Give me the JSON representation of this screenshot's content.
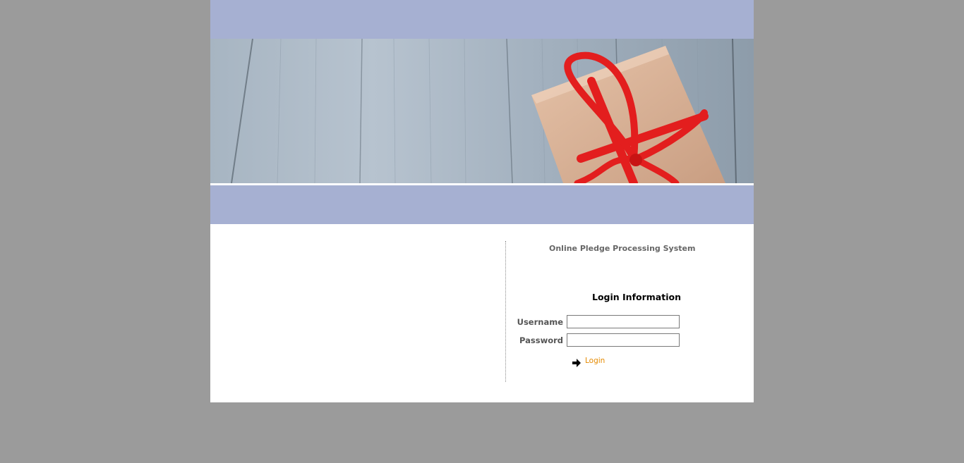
{
  "header": {
    "banner_image": "gift-box-on-wooden-boards"
  },
  "main": {
    "system_title": "Online Pledge Processing System",
    "login_heading": "Login Information",
    "username": {
      "label": "Username",
      "value": ""
    },
    "password": {
      "label": "Password",
      "value": ""
    },
    "login_link": {
      "icon": "arrow-right-icon",
      "label": "Login"
    }
  },
  "colors": {
    "page_background": "#9b9b9b",
    "band": "#a6b0d2",
    "content_background": "#ffffff",
    "link": "#e58a00",
    "label": "#555555"
  }
}
